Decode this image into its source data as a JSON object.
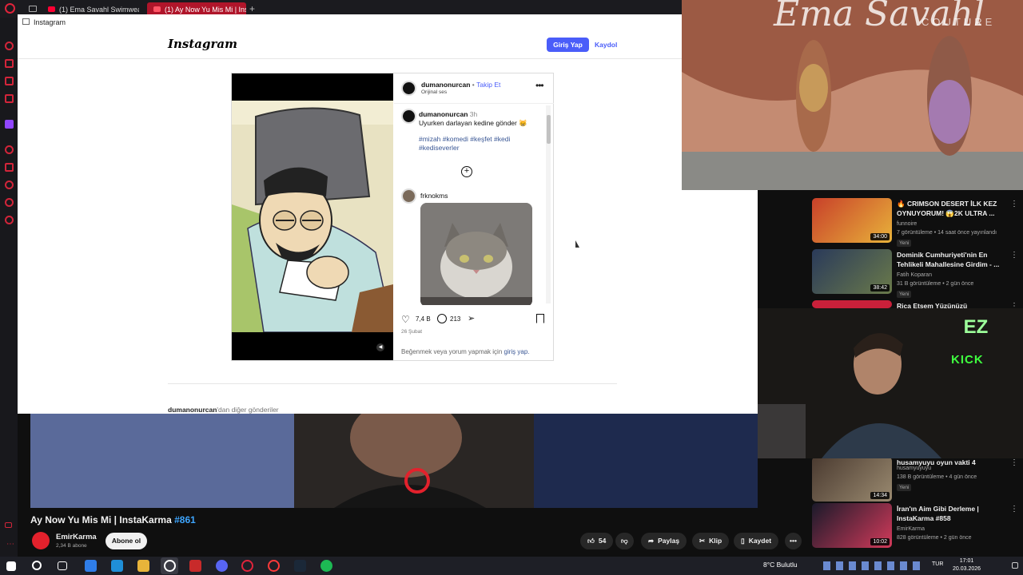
{
  "browser": {
    "tabs": [
      {
        "label": "(1) Ema Savahl Swimwear"
      },
      {
        "label": "(1) Ay Now Yu Mis Mi | Inst"
      }
    ],
    "new_tab": "+"
  },
  "instagram": {
    "window_title": "Instagram",
    "logo": "Instagram",
    "login_button": "Giriş Yap",
    "signup_button": "Kaydol",
    "post": {
      "username": "dumanonurcan",
      "dot": "•",
      "follow": "Takip Et",
      "audio": "Orijinal ses",
      "caption_user": "dumanonurcan",
      "caption_time": "3h",
      "caption": "Uyurken darlayan kedine gönder 😸",
      "hashtags": "#mizah #komedi #keşfet #kedi #kediseverler",
      "comment_user": "frknokms",
      "likes": "7,4 B",
      "comments": "213",
      "date": "26 Şubat",
      "login_prompt": "Beğenmek veya yorum yapmak için",
      "login_link": "giriş yap."
    },
    "more_posts_user": "dumanonurcan",
    "more_posts_suffix": "'dan diğer gönderiler"
  },
  "runway": {
    "brand": "Ema Savahl",
    "sub": "COUTURE"
  },
  "recommendations": [
    {
      "title": "🔥 CRIMSON DESERT İLK KEZ OYNUYORUM! 😱2K ULTRA ...",
      "channel": "funnoire",
      "meta": "7 görüntüleme • 14 saat önce yayınlandı",
      "badge": "Yeni",
      "duration": "34:00"
    },
    {
      "title": "Dominik Cumhuriyeti'nin En Tehlikeli Mahallesine Girdim - ...",
      "channel": "Fatih Koparan",
      "meta": "31 B görüntüleme • 2 gün önce",
      "badge": "Yeni",
      "duration": "38:42"
    },
    {
      "title": "Rica Etsem Yüzünüzü",
      "channel": "",
      "meta": "",
      "badge": "",
      "duration": ""
    },
    {
      "title": "husamyuyu oyun vakti 4",
      "channel": "husamyuyuyu",
      "meta": "138 B görüntüleme • 4 gün önce",
      "badge": "Yeni",
      "duration": "14:34"
    },
    {
      "title": "İran'ın Aim Gibi Derleme | InstaKarma #858",
      "channel": "EmirKarma",
      "meta": "828 görüntüleme • 2 gün önce",
      "badge": "",
      "duration": "10:02"
    }
  ],
  "webcam": {
    "badge": "EZ",
    "kick": "KICK"
  },
  "video": {
    "title": "Ay Now Yu Mis Mi | InstaKarma",
    "tag": "#861",
    "channel": "EmirKarma",
    "subs": "2,34 B abone",
    "subscribe": "Abone ol",
    "likes": "54",
    "share": "Paylaş",
    "clip": "Klip",
    "save": "Kaydet",
    "more": "•••"
  },
  "taskbar": {
    "weather": "8°C  Bulutlu",
    "lang": "TUR",
    "time": "17:01",
    "date": "20.03.2026"
  },
  "colors": {
    "ig_blue": "#4a5df9",
    "yt_bg": "#0f0f0f",
    "opera_red": "#d2253a"
  }
}
